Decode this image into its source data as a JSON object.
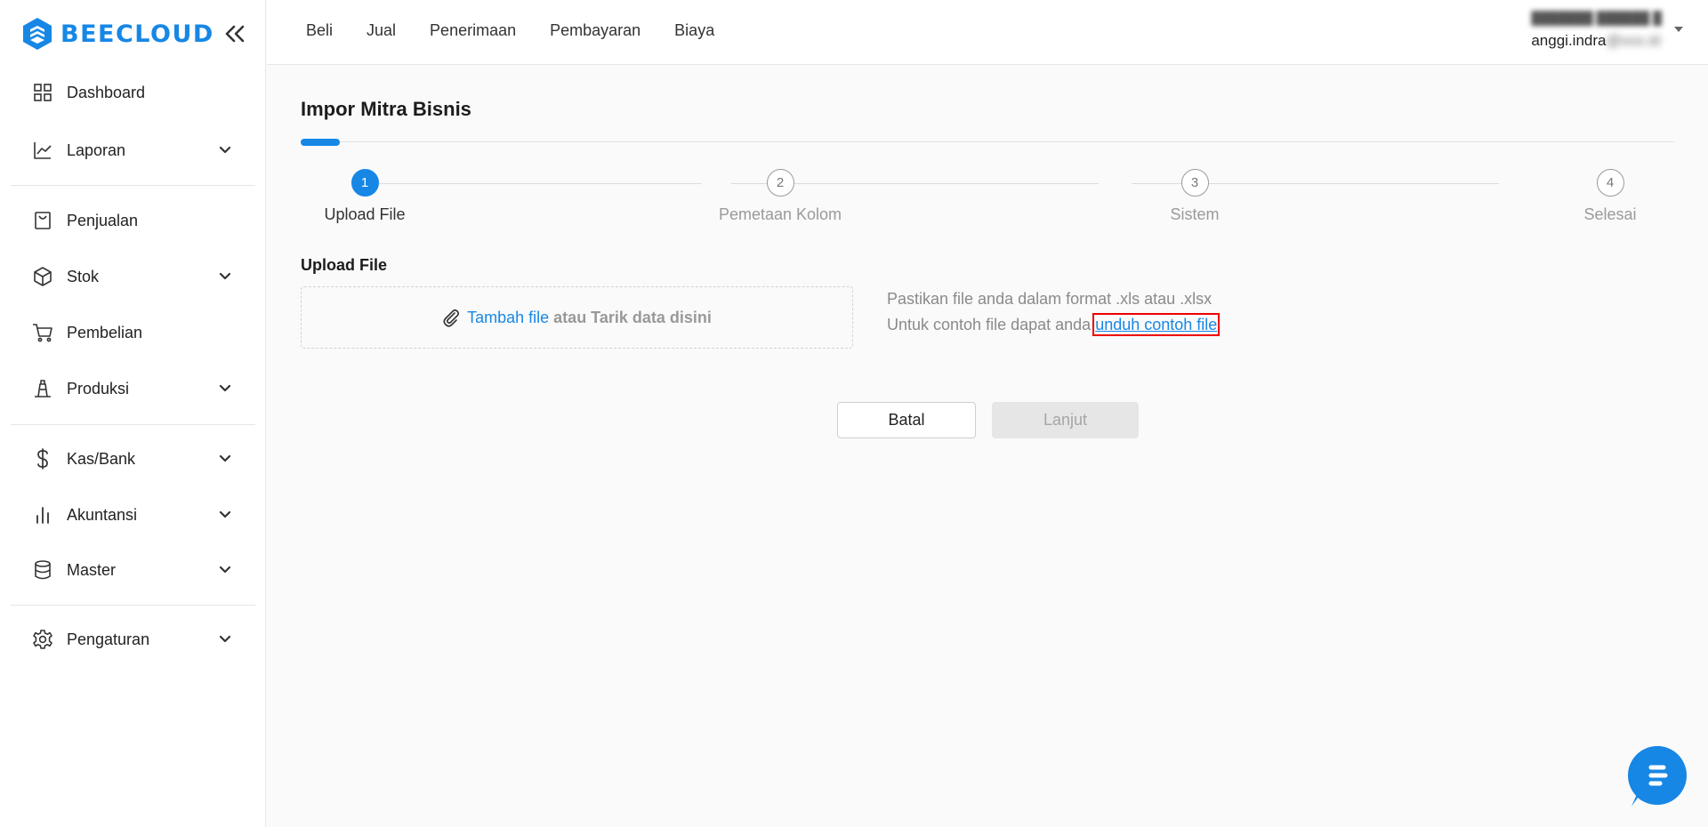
{
  "brand": {
    "name": "BEECLOUD",
    "accent": "#1787e5"
  },
  "sidebar": {
    "items": [
      {
        "label": "Dashboard",
        "icon": "grid-icon",
        "has_chevron": false
      },
      {
        "label": "Laporan",
        "icon": "line-chart-icon",
        "has_chevron": true
      },
      {
        "label": "Penjualan",
        "icon": "shopping-bag-icon",
        "has_chevron": false
      },
      {
        "label": "Stok",
        "icon": "box-icon",
        "has_chevron": true
      },
      {
        "label": "Pembelian",
        "icon": "cart-icon",
        "has_chevron": false
      },
      {
        "label": "Produksi",
        "icon": "factory-icon",
        "has_chevron": true
      },
      {
        "label": "Kas/Bank",
        "icon": "dollar-icon",
        "has_chevron": true
      },
      {
        "label": "Akuntansi",
        "icon": "bar-chart-icon",
        "has_chevron": true
      },
      {
        "label": "Master",
        "icon": "database-icon",
        "has_chevron": true
      },
      {
        "label": "Pengaturan",
        "icon": "gear-icon",
        "has_chevron": true
      }
    ]
  },
  "topnav": {
    "items": [
      "Beli",
      "Jual",
      "Penerimaan",
      "Pembayaran",
      "Biaya"
    ]
  },
  "user": {
    "email_visible": "anggi.indra"
  },
  "page": {
    "title": "Impor Mitra Bisnis",
    "steps": [
      {
        "number": "1",
        "label": "Upload File",
        "active": true
      },
      {
        "number": "2",
        "label": "Pemetaan Kolom",
        "active": false
      },
      {
        "number": "3",
        "label": "Sistem",
        "active": false
      },
      {
        "number": "4",
        "label": "Selesai",
        "active": false
      }
    ],
    "upload_section_label": "Upload File",
    "dropzone": {
      "link_text": "Tambah file",
      "rest_text": "atau Tarik data disini"
    },
    "info": {
      "line1": "Pastikan file anda dalam format .xls atau .xlsx",
      "line2_prefix": "Untuk contoh file dapat anda",
      "line2_link": "unduh contoh file"
    },
    "buttons": {
      "cancel": "Batal",
      "next": "Lanjut"
    }
  }
}
